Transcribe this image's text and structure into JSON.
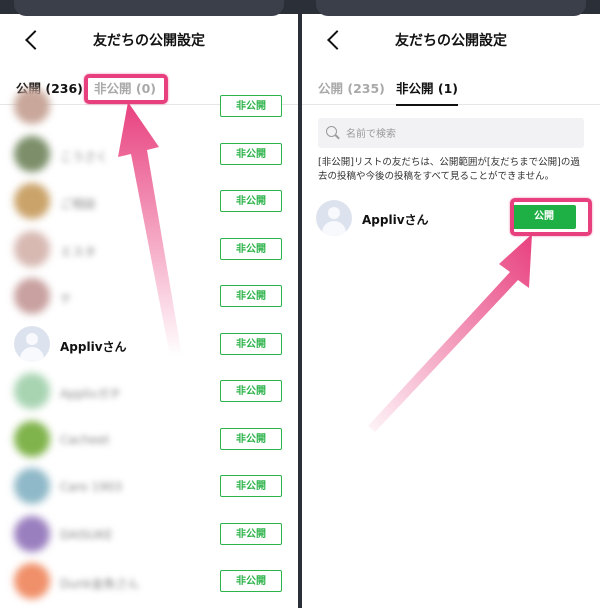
{
  "left": {
    "title": "友だちの公開設定",
    "tabs": [
      {
        "label": "公開 (236)",
        "active": true
      },
      {
        "label": "非公開 (0)",
        "active": false
      }
    ],
    "friends": [
      {
        "name": "",
        "button": "非公開",
        "blurred": true,
        "color": "#c9a79a"
      },
      {
        "name": "こうさく",
        "button": "非公開",
        "blurred": true,
        "color": "#7c8f6a"
      },
      {
        "name": "ご相談",
        "button": "非公開",
        "blurred": true,
        "color": "#caa36a"
      },
      {
        "name": "ミスタ",
        "button": "非公開",
        "blurred": true,
        "color": "#d7b9b2"
      },
      {
        "name": "ケ",
        "button": "非公開",
        "blurred": true,
        "color": "#c8a1a0"
      },
      {
        "name": "Applivさん",
        "button": "非公開",
        "blurred": false,
        "color": "#dde3ee"
      },
      {
        "name": "Applivガチ",
        "button": "非公開",
        "blurred": true,
        "color": "#a8d4b2"
      },
      {
        "name": "Cacheet",
        "button": "非公開",
        "blurred": true,
        "color": "#7fb34b"
      },
      {
        "name": "Caro 1903",
        "button": "非公開",
        "blurred": true,
        "color": "#8fb8c8"
      },
      {
        "name": "DAISUKE",
        "button": "非公開",
        "blurred": true,
        "color": "#9a7fbf"
      },
      {
        "name": "Dunk金魚さん",
        "button": "非公開",
        "blurred": true,
        "color": "#f0906a"
      }
    ]
  },
  "right": {
    "title": "友だちの公開設定",
    "tabs": [
      {
        "label": "公開 (235)",
        "active": false
      },
      {
        "label": "非公開 (1)",
        "active": true
      }
    ],
    "search": {
      "placeholder": "名前で検索"
    },
    "notice": "[非公開]リストの友だちは、公開範囲が[友だちまで公開]の過去の投稿や今後の投稿をすべて見ることができません。",
    "friend": {
      "name": "Applivさん",
      "button": "公開"
    }
  },
  "colors": {
    "accent": "#e8407e",
    "green": "#1fb045"
  }
}
